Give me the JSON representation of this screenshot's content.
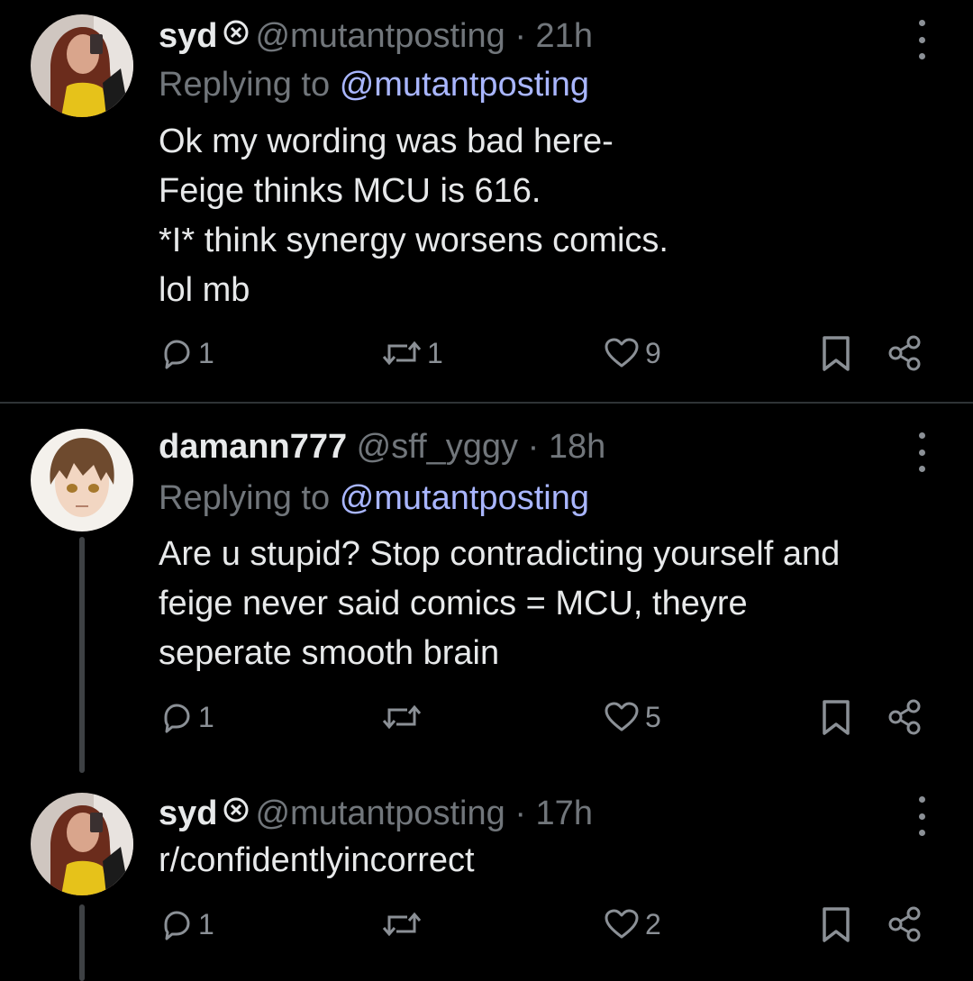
{
  "tweets": [
    {
      "name": "syd",
      "handle": "@mutantposting",
      "sep": "·",
      "time": "21h",
      "replying_prefix": "Replying to",
      "replying_to": "@mutantposting",
      "lines": [
        "Ok my wording was bad here-",
        "Feige thinks MCU is 616.",
        "*I* think synergy worsens comics.",
        "lol mb"
      ],
      "replies": "1",
      "retweets": "1",
      "likes": "9"
    },
    {
      "name": "damann777",
      "handle": "@sff_yggy",
      "sep": "·",
      "time": "18h",
      "replying_prefix": "Replying to",
      "replying_to": "@mutantposting",
      "lines": [
        "Are u stupid? Stop contradicting yourself and",
        "feige never said comics = MCU, theyre",
        "seperate smooth brain"
      ],
      "replies": "1",
      "retweets": "",
      "likes": "5"
    },
    {
      "name": "syd",
      "handle": "@mutantposting",
      "sep": "·",
      "time": "17h",
      "lines": [
        "r/confidentlyincorrect"
      ],
      "replies": "1",
      "retweets": "",
      "likes": "2"
    }
  ],
  "icons": {
    "badge": "circle-x-icon",
    "more": "more-vertical-icon",
    "reply": "reply-icon",
    "retweet": "retweet-icon",
    "like": "heart-icon",
    "bookmark": "bookmark-icon",
    "share": "share-icon"
  },
  "colors": {
    "background": "#000000",
    "text": "#e7e9ea",
    "muted": "#71767b",
    "mention": "#a9b6ff"
  }
}
